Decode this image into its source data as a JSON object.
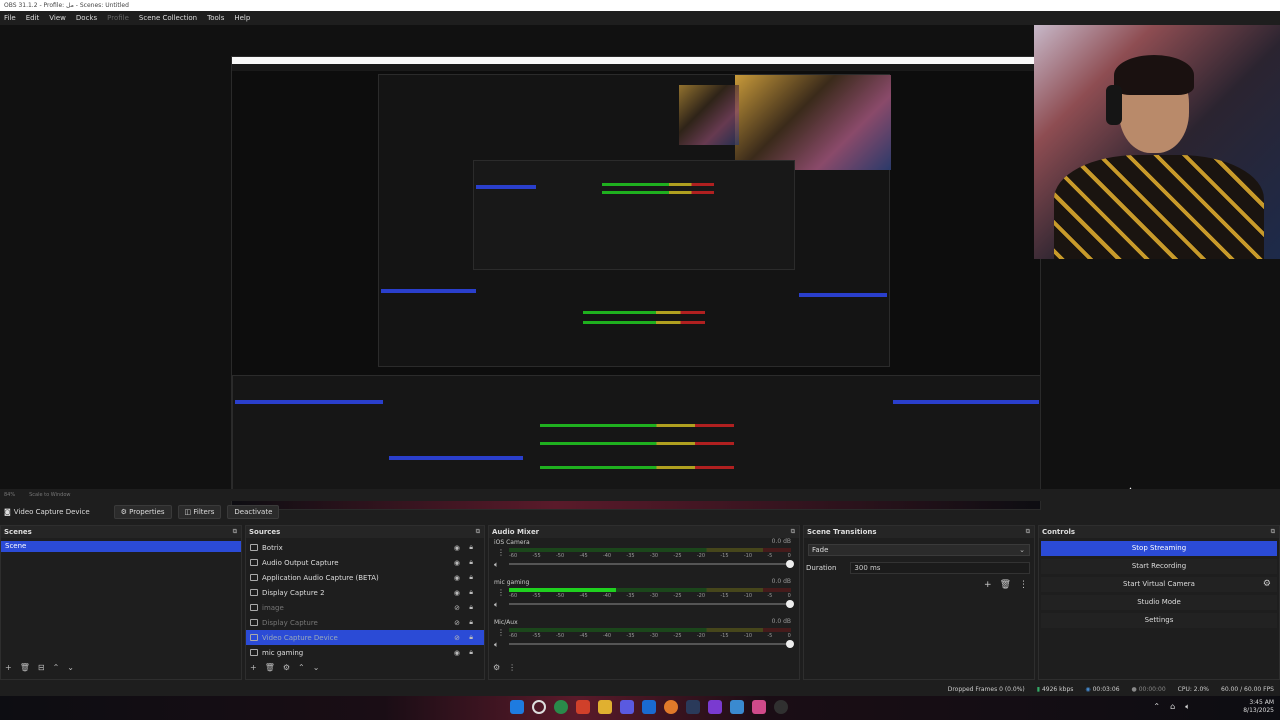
{
  "window": {
    "title": "OBS 31.1.2 - Profile: مل - Scenes: Untitled"
  },
  "menu": {
    "items": [
      "File",
      "Edit",
      "View",
      "Docks",
      "Profile",
      "Scene Collection",
      "Tools",
      "Help"
    ]
  },
  "preview": {
    "zoom": "84%",
    "scale_label": "Scale to Window"
  },
  "toolbar": {
    "source_name": "Video Capture Device",
    "properties": "Properties",
    "filters": "Filters",
    "deactivate": "Deactivate"
  },
  "scenes": {
    "title": "Scenes",
    "items": [
      "Scene"
    ]
  },
  "sources": {
    "title": "Sources",
    "items": [
      {
        "name": "Botrix",
        "visible": true
      },
      {
        "name": "Audio Output Capture",
        "visible": true
      },
      {
        "name": "Application Audio Capture (BETA)",
        "visible": true
      },
      {
        "name": "Display Capture 2",
        "visible": true
      },
      {
        "name": "image",
        "visible": false
      },
      {
        "name": "Display Capture",
        "visible": false
      },
      {
        "name": "Video Capture Device",
        "visible": false,
        "selected": true
      },
      {
        "name": "mic gaming",
        "visible": true
      }
    ]
  },
  "mixer": {
    "title": "Audio Mixer",
    "channels": [
      {
        "name": "iOS Camera",
        "db": "0.0 dB",
        "level": 0.0
      },
      {
        "name": "mic gaming",
        "db": "0.0 dB",
        "level": 0.38
      },
      {
        "name": "Mic/Aux",
        "db": "0.0 dB",
        "level": 0.0
      }
    ],
    "ticks": [
      "-60",
      "-55",
      "-50",
      "-45",
      "-40",
      "-35",
      "-30",
      "-25",
      "-20",
      "-15",
      "-10",
      "-5",
      "0"
    ]
  },
  "transitions": {
    "title": "Scene Transitions",
    "selected": "Fade",
    "duration_label": "Duration",
    "duration": "300 ms"
  },
  "controls": {
    "title": "Controls",
    "stop_streaming": "Stop Streaming",
    "start_recording": "Start Recording",
    "start_virtual_camera": "Start Virtual Camera",
    "studio_mode": "Studio Mode",
    "settings": "Settings"
  },
  "status": {
    "dropped": "Dropped Frames 0 (0.0%)",
    "bitrate": "4926 kbps",
    "stream_time": "00:03:06",
    "rec_time": "00:00:00",
    "cpu": "CPU: 2.0%",
    "fps": "60.00 / 60.00 FPS"
  },
  "clock": {
    "time": "3:45 AM",
    "date": "8/13/2025"
  }
}
